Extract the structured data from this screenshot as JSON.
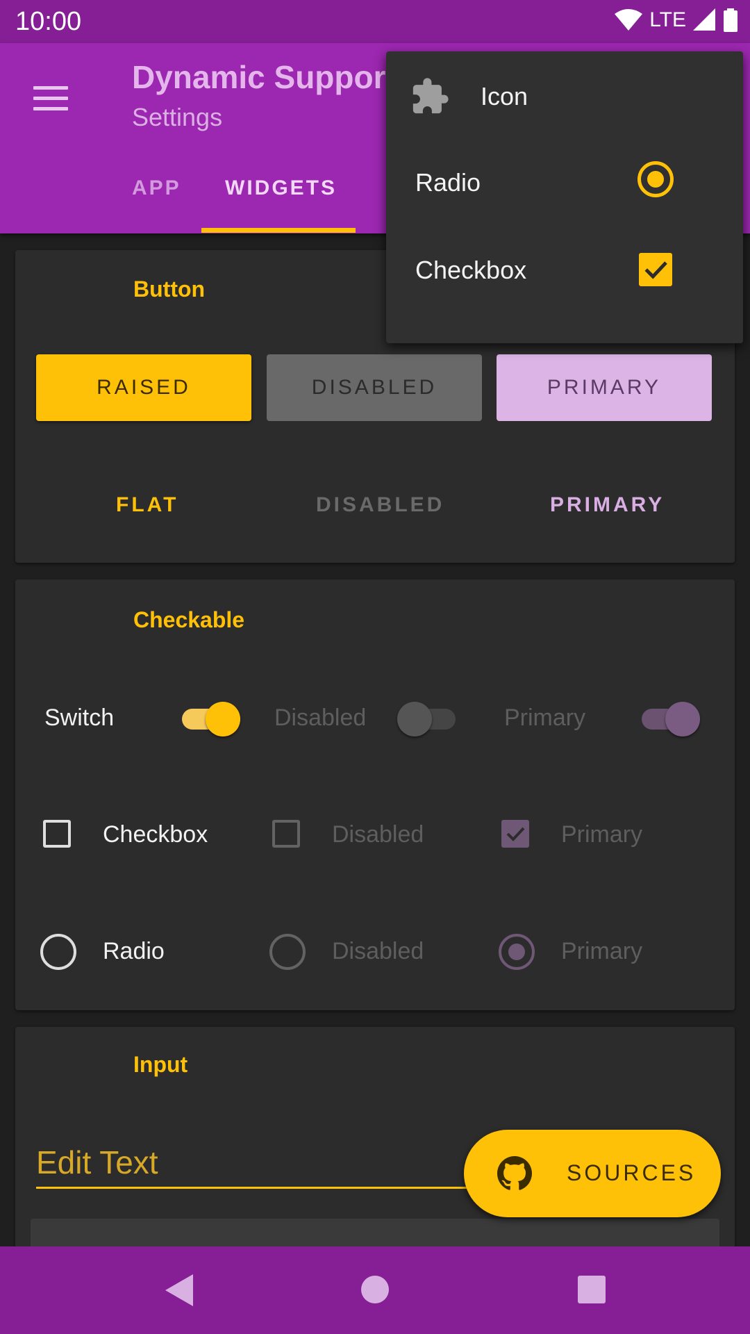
{
  "status_bar": {
    "time": "10:00",
    "network": "LTE"
  },
  "app_bar": {
    "title": "Dynamic Support",
    "subtitle": "Settings",
    "tabs": [
      {
        "label": "APP",
        "selected": false
      },
      {
        "label": "WIDGETS",
        "selected": true
      }
    ]
  },
  "button_card": {
    "title": "Button",
    "raised": [
      "RAISED",
      "DISABLED",
      "PRIMARY"
    ],
    "flat": [
      "FLAT",
      "DISABLED",
      "PRIMARY"
    ]
  },
  "checkable_card": {
    "title": "Checkable",
    "switch_row": {
      "label": "Switch",
      "disabled": "Disabled",
      "primary": "Primary"
    },
    "checkbox_row": {
      "label": "Checkbox",
      "disabled": "Disabled",
      "primary": "Primary"
    },
    "radio_row": {
      "label": "Radio",
      "disabled": "Disabled",
      "primary": "Primary"
    }
  },
  "input_card": {
    "title": "Input",
    "edit_text": "Edit Text"
  },
  "popup_menu": {
    "items": [
      {
        "label": "Icon",
        "icon": "puzzle-icon"
      },
      {
        "label": "Radio",
        "control": "radio",
        "checked": true
      },
      {
        "label": "Checkbox",
        "control": "checkbox",
        "checked": true
      }
    ]
  },
  "fab": {
    "label": "SOURCES",
    "icon": "github-icon"
  },
  "colors": {
    "primary": "#9c27b0",
    "primary_dark": "#861f96",
    "accent": "#ffc107",
    "primary_light": "#dcb4e6",
    "surface": "#2c2c2c",
    "background": "#1f1f1f"
  }
}
